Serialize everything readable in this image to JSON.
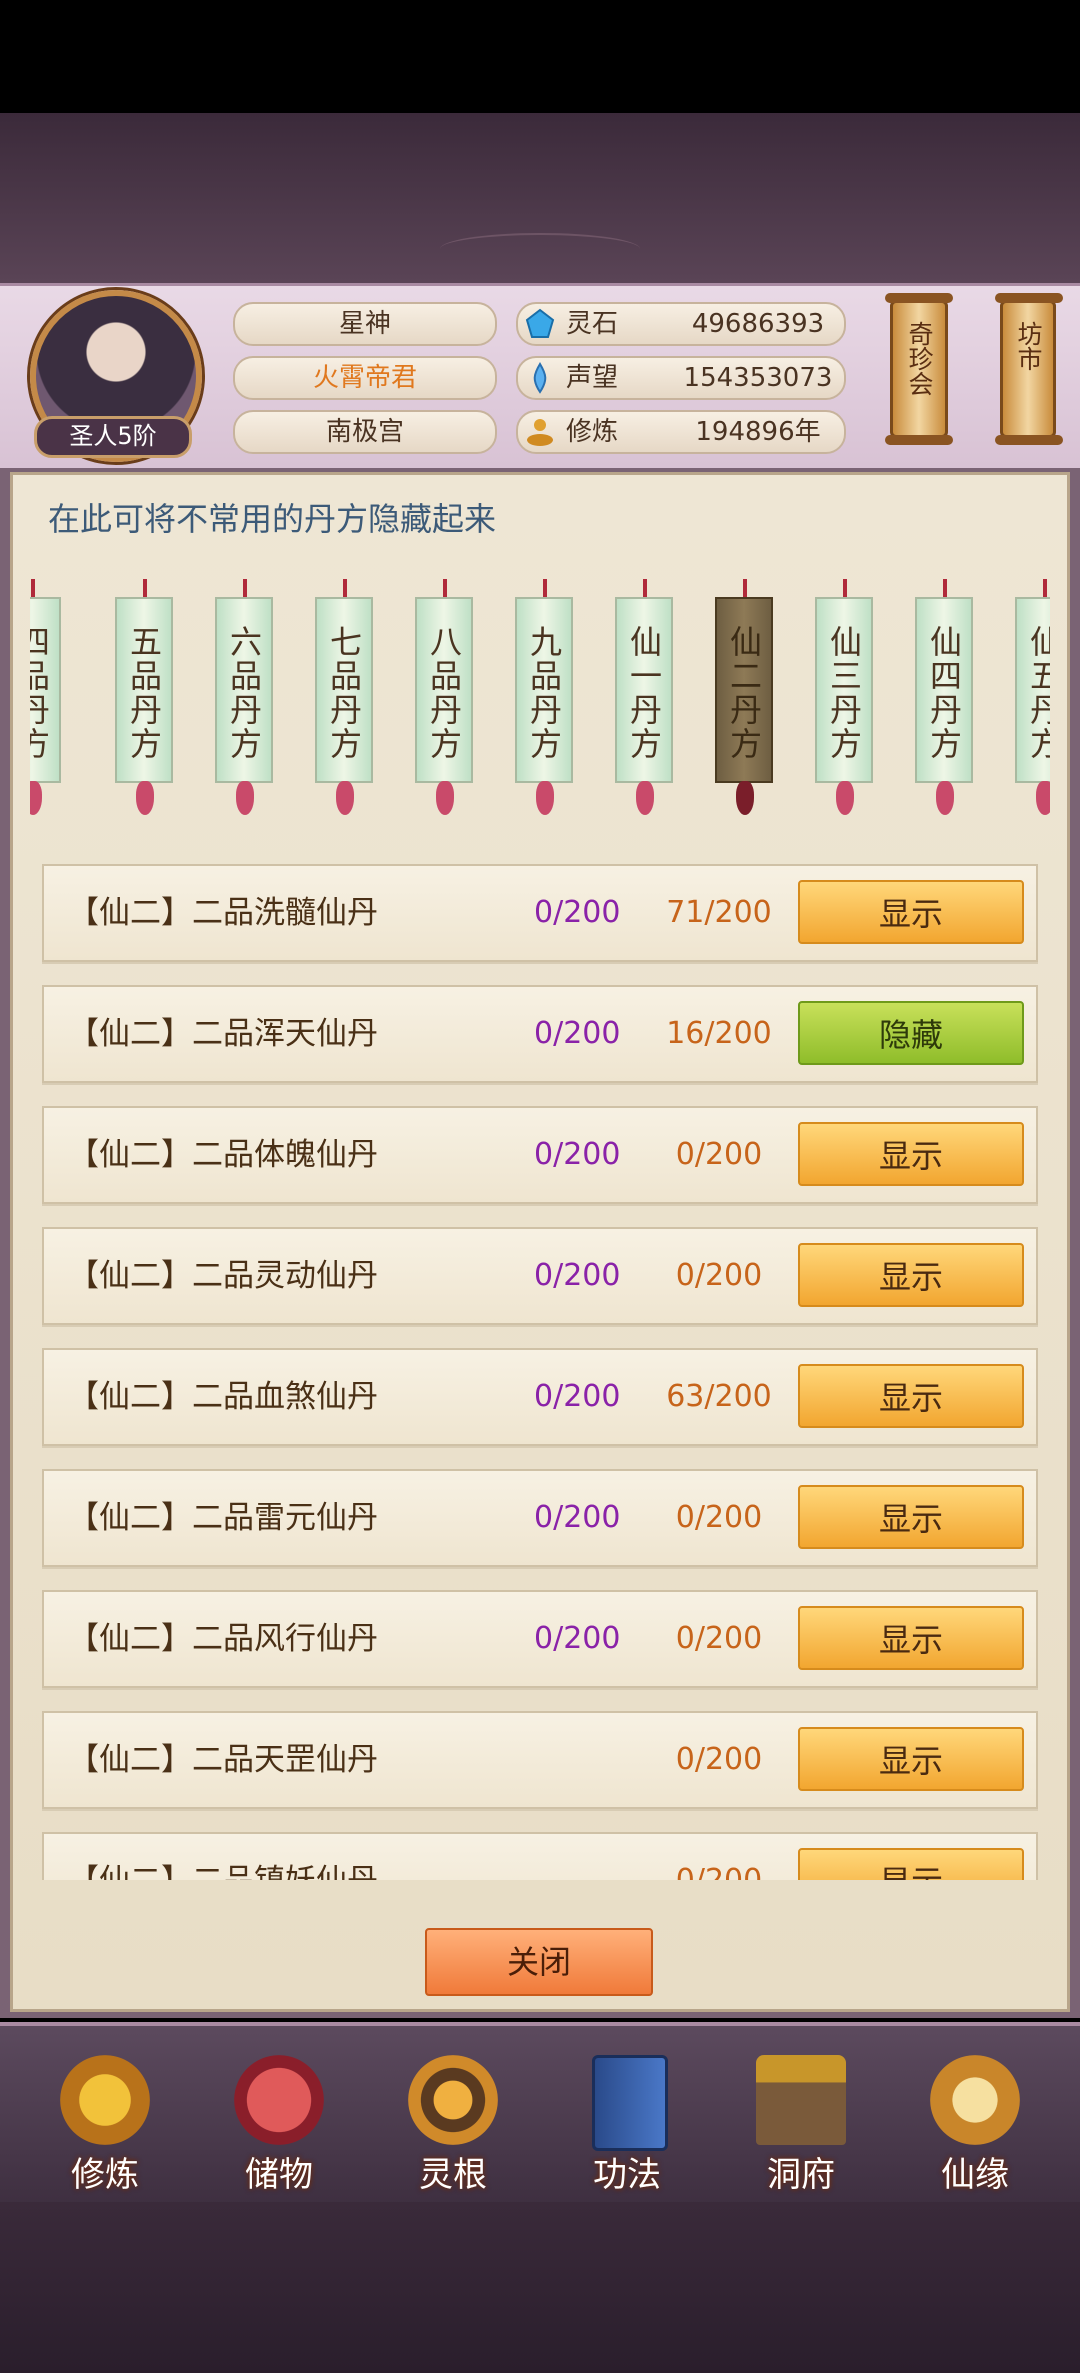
{
  "player": {
    "rank": "圣人5阶",
    "name_lines": [
      "星神",
      "火霄帝君",
      "南极宫"
    ]
  },
  "resources": [
    {
      "label": "灵石",
      "value": "49686393",
      "icon": "spirit-stone-icon"
    },
    {
      "label": "声望",
      "value": "154353073",
      "icon": "reputation-icon"
    },
    {
      "label": "修炼",
      "value": "194896年",
      "icon": "meditation-icon"
    }
  ],
  "side_buttons": {
    "treasure": "奇珍会",
    "market": "坊市"
  },
  "panel": {
    "hint": "在此可将不常用的丹方隐藏起来",
    "tabs": [
      {
        "label": "四品丹方",
        "active": false
      },
      {
        "label": "五品丹方",
        "active": false
      },
      {
        "label": "六品丹方",
        "active": false
      },
      {
        "label": "七品丹方",
        "active": false
      },
      {
        "label": "八品丹方",
        "active": false
      },
      {
        "label": "九品丹方",
        "active": false
      },
      {
        "label": "仙一丹方",
        "active": false
      },
      {
        "label": "仙二丹方",
        "active": true
      },
      {
        "label": "仙三丹方",
        "active": false
      },
      {
        "label": "仙四丹方",
        "active": false
      },
      {
        "label": "仙五丹方",
        "active": false
      }
    ],
    "recipes": [
      {
        "name": "【仙二】二品洗髓仙丹",
        "count_a": "0/200",
        "count_b": "71/200",
        "action": "显示"
      },
      {
        "name": "【仙二】二品浑天仙丹",
        "count_a": "0/200",
        "count_b": "16/200",
        "action": "隐藏"
      },
      {
        "name": "【仙二】二品体魄仙丹",
        "count_a": "0/200",
        "count_b": "0/200",
        "action": "显示"
      },
      {
        "name": "【仙二】二品灵动仙丹",
        "count_a": "0/200",
        "count_b": "0/200",
        "action": "显示"
      },
      {
        "name": "【仙二】二品血煞仙丹",
        "count_a": "0/200",
        "count_b": "63/200",
        "action": "显示"
      },
      {
        "name": "【仙二】二品雷元仙丹",
        "count_a": "0/200",
        "count_b": "0/200",
        "action": "显示"
      },
      {
        "name": "【仙二】二品风行仙丹",
        "count_a": "0/200",
        "count_b": "0/200",
        "action": "显示"
      },
      {
        "name": "【仙二】二品天罡仙丹",
        "count_a": "",
        "count_b": "0/200",
        "action": "显示"
      },
      {
        "name": "【仙二】二品镇妖仙丹",
        "count_a": "",
        "count_b": "0/200",
        "action": "显示"
      }
    ],
    "close_label": "关闭"
  },
  "nav": [
    {
      "label": "修炼",
      "icon": "cultivation-icon"
    },
    {
      "label": "储物",
      "icon": "storage-bag-icon"
    },
    {
      "label": "灵根",
      "icon": "spirit-root-icon"
    },
    {
      "label": "功法",
      "icon": "skill-book-icon"
    },
    {
      "label": "洞府",
      "icon": "cave-abode-icon"
    },
    {
      "label": "仙缘",
      "icon": "immortal-fate-icon"
    }
  ],
  "colors": {
    "accent_text": "#e0781e",
    "count_a": "#8a22a8",
    "count_b": "#c7641a",
    "show_button": "#f2a630",
    "hide_button": "#8fbd2a"
  }
}
